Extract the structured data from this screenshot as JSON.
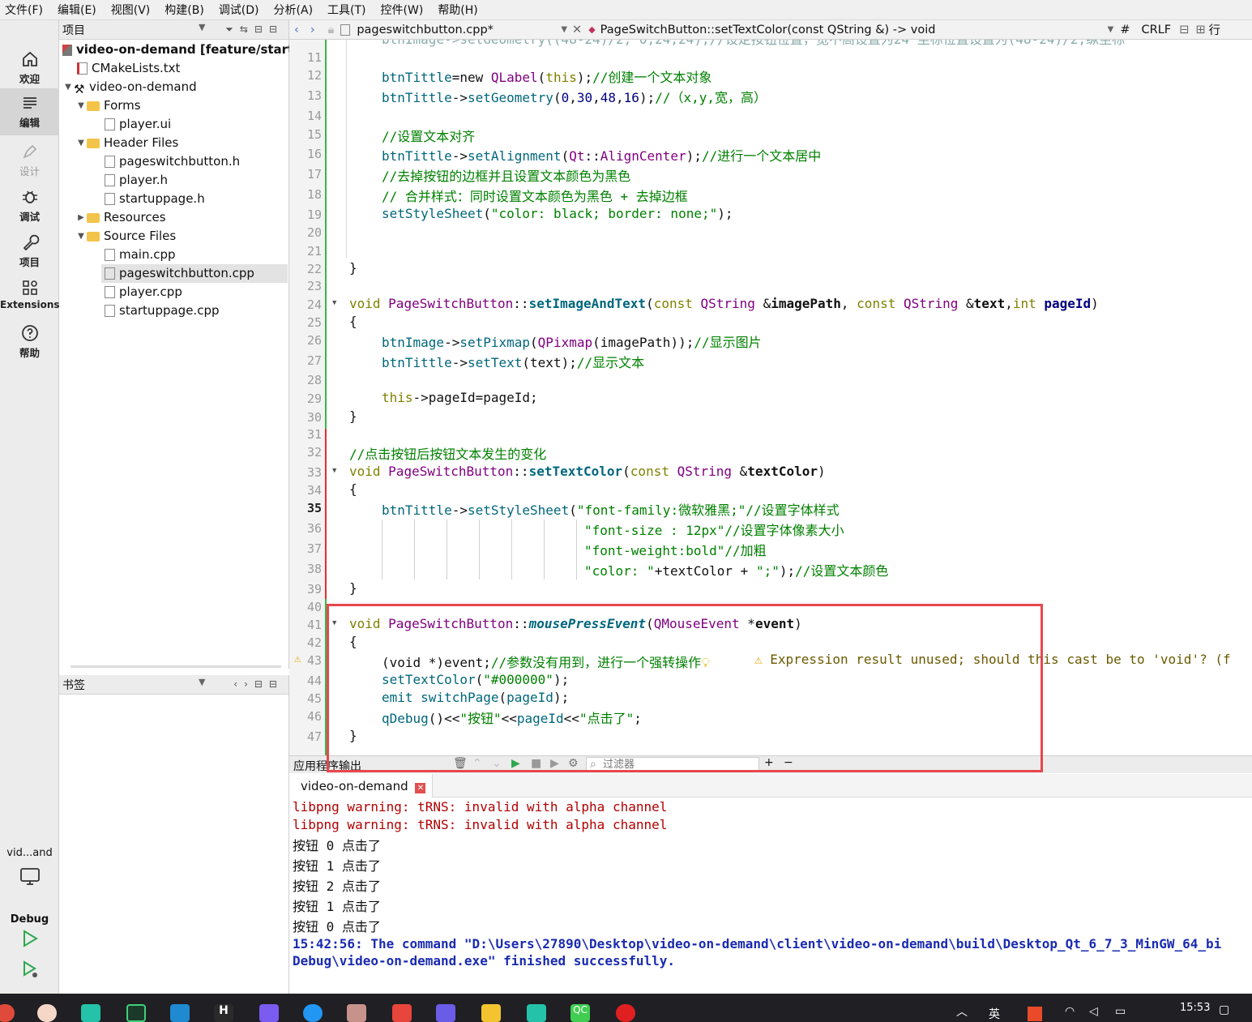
{
  "menu": [
    "文件(F)",
    "编辑(E)",
    "视图(V)",
    "构建(B)",
    "调试(D)",
    "分析(A)",
    "工具(T)",
    "控件(W)",
    "帮助(H)"
  ],
  "modes": [
    {
      "label": "欢迎",
      "icon": "home-icon"
    },
    {
      "label": "编辑",
      "icon": "edit-icon"
    },
    {
      "label": "设计",
      "icon": "design-pen-icon"
    },
    {
      "label": "调试",
      "icon": "bug-icon"
    },
    {
      "label": "项目",
      "icon": "wrench-icon"
    },
    {
      "label": "Extensions",
      "icon": "extensions-icon"
    },
    {
      "label": "帮助",
      "icon": "help-icon"
    }
  ],
  "kit": {
    "name": "vid...and",
    "build": "Debug"
  },
  "project_panel": {
    "title": "项目",
    "tree": [
      {
        "label": "video-on-demand [feature/startu",
        "bold": true
      },
      {
        "label": "CMakeLists.txt"
      },
      {
        "label": "video-on-demand"
      },
      {
        "label": "Forms"
      },
      {
        "label": "player.ui"
      },
      {
        "label": "Header Files"
      },
      {
        "label": "pageswitchbutton.h"
      },
      {
        "label": "player.h"
      },
      {
        "label": "startuppage.h"
      },
      {
        "label": "Resources"
      },
      {
        "label": "Source Files"
      },
      {
        "label": "main.cpp"
      },
      {
        "label": "pageswitchbutton.cpp",
        "selected": true
      },
      {
        "label": "player.cpp"
      },
      {
        "label": "startuppage.cpp"
      }
    ]
  },
  "bookmarks_panel": {
    "title": "书签"
  },
  "editor": {
    "file_tab": "pageswitchbutton.cpp*",
    "function_tab": "PageSwitchButton::setTextColor(const QString &) -> void",
    "line_ending": "CRLF",
    "hash": "#",
    "position_label": "行",
    "current_line": 35,
    "line_numbers": [
      11,
      12,
      13,
      14,
      15,
      16,
      17,
      18,
      19,
      20,
      21,
      22,
      23,
      24,
      25,
      26,
      27,
      28,
      29,
      30,
      31,
      32,
      33,
      34,
      35,
      36,
      37,
      38,
      39,
      40,
      41,
      42,
      43,
      44,
      45,
      46,
      47
    ],
    "code": {
      "l12a": "btnTittle",
      "l12b": "=new ",
      "l12c": "QLabel",
      "l12d": "(",
      "l12e": "this",
      "l12f": ");",
      "l12g": "//创建一个文本对象",
      "l13a": "btnTittle",
      "l13b": "->",
      "l13c": "setGeometry",
      "l13d": "(",
      "l13e": "0",
      "l13f": ",",
      "l13g": "30",
      "l13h": ",",
      "l13i": "48",
      "l13j": ",",
      "l13k": "16",
      "l13l": ");",
      "l13m": "//（x,y,宽，高）",
      "l15": "//设置文本对齐",
      "l16a": "btnTittle",
      "l16b": "->",
      "l16c": "setAlignment",
      "l16d": "(",
      "l16e": "Qt",
      "l16f": "::",
      "l16g": "AlignCenter",
      "l16h": ");",
      "l16i": "//进行一个文本居中",
      "l17": "//去掉按钮的边框并且设置文本颜色为黑色",
      "l18": "// 合并样式：同时设置文本颜色为黑色 + 去掉边框",
      "l19a": "setStyleSheet",
      "l19b": "(",
      "l19c": "\"color: black; border: none;\"",
      "l19d": ");",
      "l22": "}",
      "l24a": "void ",
      "l24b": "PageSwitchButton",
      "l24c": "::",
      "l24d": "setImageAndText",
      "l24e": "(",
      "l24f": "const ",
      "l24g": "QString ",
      "l24h": "&",
      "l24i": "imagePath",
      "l24j": ", ",
      "l24k": "const ",
      "l24l": "QString ",
      "l24m": "&",
      "l24n": "text",
      "l24o": ",",
      "l24p": "int ",
      "l24q": "pageId",
      "l24r": ")",
      "l25": "{",
      "l26a": "btnImage",
      "l26b": "->",
      "l26c": "setPixmap",
      "l26d": "(",
      "l26e": "QPixmap",
      "l26f": "(imagePath));",
      "l26g": "//显示图片",
      "l27a": "btnTittle",
      "l27b": "->",
      "l27c": "setText",
      "l27d": "(text);",
      "l27e": "//显示文本",
      "l29a": "this",
      "l29b": "->",
      "l29c": "pageId",
      "l29d": "=pageId;",
      "l30": "}",
      "l32": "//点击按钮后按钮文本发生的变化",
      "l33a": "void ",
      "l33b": "PageSwitchButton",
      "l33c": "::",
      "l33d": "setTextColor",
      "l33e": "(",
      "l33f": "const ",
      "l33g": "QString ",
      "l33h": "&",
      "l33i": "textColor",
      "l33j": ")",
      "l34": "{",
      "l35a": "btnTittle",
      "l35b": "->",
      "l35c": "setStyleSheet",
      "l35d": "(",
      "l35e": "\"font-family:微软雅黑;\"",
      "l35f": "//设置字体样式",
      "l36a": "\"font-size : 12px\"",
      "l36b": "//设置字体像素大小",
      "l37a": "\"font-weight:bold\"",
      "l37b": "//加粗",
      "l38a": "\"color: \"",
      "l38b": "+textColor + ",
      "l38c": "\";\"",
      "l38d": ");",
      "l38e": "//设置文本颜色",
      "l39": "}",
      "l41a": "void ",
      "l41b": "PageSwitchButton",
      "l41c": "::",
      "l41d": "mousePressEvent",
      "l41e": "(",
      "l41f": "QMouseEvent ",
      "l41g": "*",
      "l41h": "event",
      "l41i": ")",
      "l42": "{",
      "l43a": "(void *)event;",
      "l43b": "//参数没有用到，进行一个强转操作",
      "l43warn": "Expression result unused; should this cast be to 'void'? (f",
      "l44a": "setTextColor",
      "l44b": "(",
      "l44c": "\"#000000\"",
      "l44d": ");",
      "l45a": "emit ",
      "l45b": "switchPage",
      "l45c": "(",
      "l45d": "pageId",
      "l45e": ");",
      "l46a": "qDebug",
      "l46b": "()<<",
      "l46c": "\"按钮\"",
      "l46d": "<<",
      "l46e": "pageId",
      "l46f": "<<",
      "l46g": "\"点击了\"",
      "l46h": ";",
      "l47": "}"
    }
  },
  "output_pane": {
    "title": "应用程序输出",
    "filter_placeholder": "过滤器",
    "tab": "video-on-demand",
    "lines": [
      {
        "text": "libpng warning: tRNS: invalid with alpha channel",
        "type": "error"
      },
      {
        "text": "libpng warning: tRNS: invalid with alpha channel",
        "type": "error"
      },
      {
        "text": "按钮 0 点击了",
        "type": "normal"
      },
      {
        "text": "按钮 1 点击了",
        "type": "normal"
      },
      {
        "text": "按钮 2 点击了",
        "type": "normal"
      },
      {
        "text": "按钮 1 点击了",
        "type": "normal"
      },
      {
        "text": "按钮 0 点击了",
        "type": "normal"
      },
      {
        "text": "15:42:56: The command \"D:\\Users\\27890\\Desktop\\video-on-demand\\client\\video-on-demand\\build\\Desktop_Qt_6_7_3_MinGW_64_bi",
        "type": "info"
      },
      {
        "text": "Debug\\video-on-demand.exe\" finished successfully.",
        "type": "info"
      }
    ]
  },
  "taskbar": {
    "time": "15:53",
    "ime": "英"
  },
  "colors": {
    "keyword": "#808000",
    "type": "#800080",
    "function": "#00677c",
    "comment": "#008000",
    "error": "#b20000",
    "info": "#1a2bb0",
    "highlight_box": "#e8474c"
  }
}
